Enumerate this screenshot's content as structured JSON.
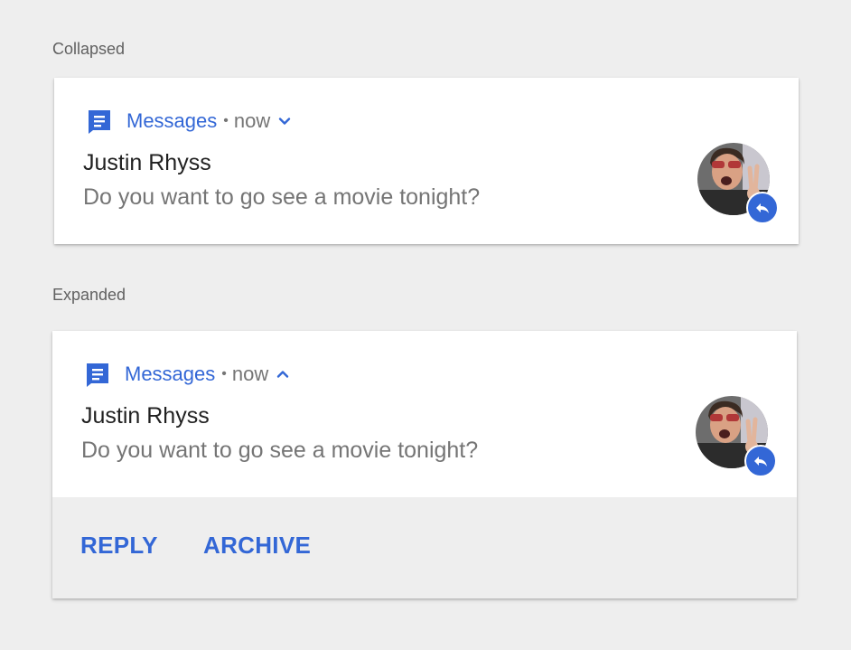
{
  "collapsed": {
    "section_label": "Collapsed",
    "app_name": "Messages",
    "separator": "•",
    "time": "now",
    "chevron_icon": "chevron-down-icon",
    "sender": "Justin Rhyss",
    "message": "Do you want to go see a movie tonight?"
  },
  "expanded": {
    "section_label": "Expanded",
    "app_name": "Messages",
    "separator": "•",
    "time": "now",
    "chevron_icon": "chevron-up-icon",
    "sender": "Justin Rhyss",
    "message": "Do you want to go see a movie tonight?",
    "actions": [
      "REPLY",
      "ARCHIVE"
    ]
  },
  "colors": {
    "accent": "#3367d6",
    "background": "#eeeeee",
    "card": "#ffffff",
    "primary_text": "#212121",
    "secondary_text": "#757575"
  }
}
